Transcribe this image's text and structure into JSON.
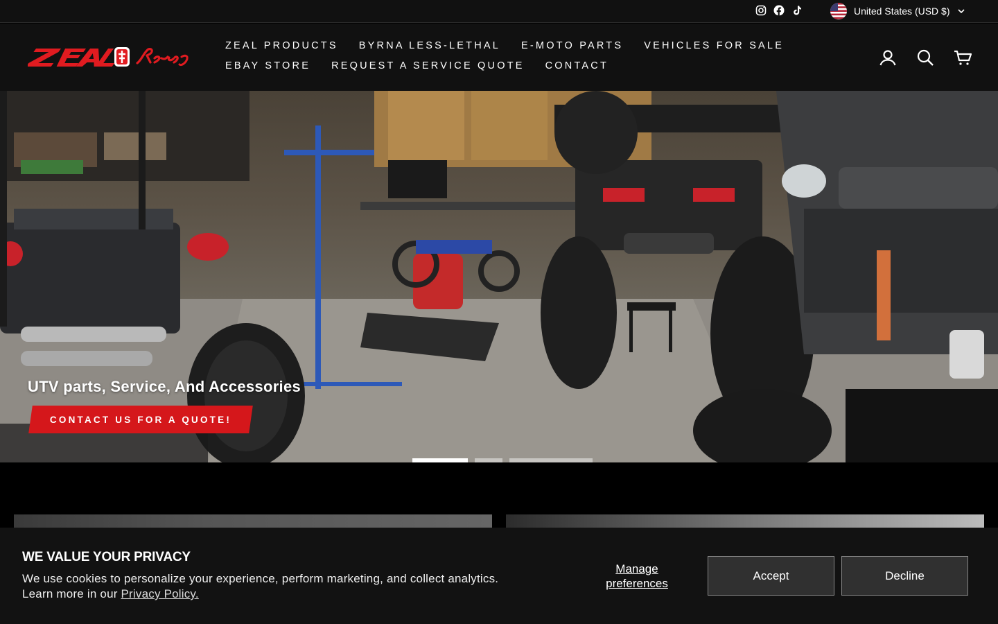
{
  "topbar": {
    "social_icons": [
      "instagram-icon",
      "facebook-icon",
      "tiktok-icon"
    ],
    "currency": "United States (USD $)"
  },
  "header": {
    "logo_alt": "ZEAL Racing",
    "nav": [
      "ZEAL PRODUCTS",
      "BYRNA LESS-LETHAL",
      "E-MOTO PARTS",
      "VEHICLES FOR SALE",
      "EBAY STORE",
      "REQUEST A SERVICE QUOTE",
      "CONTACT"
    ],
    "icons": [
      "account-icon",
      "search-icon",
      "cart-icon"
    ]
  },
  "hero": {
    "title": "UTV parts, Service, And Accessories",
    "button": "CONTACT US FOR A QUOTE!",
    "slides": 3,
    "active_slide": 1
  },
  "cookie": {
    "title": "WE VALUE YOUR PRIVACY",
    "text": "We use cookies to personalize your experience, perform marketing, and collect analytics. Learn more in our ",
    "link": "Privacy Policy.",
    "manage": "Manage preferences",
    "accept": "Accept",
    "decline": "Decline"
  },
  "colors": {
    "accent": "#d5171b",
    "header_bg": "#111111",
    "banner_bg": "#121212"
  }
}
